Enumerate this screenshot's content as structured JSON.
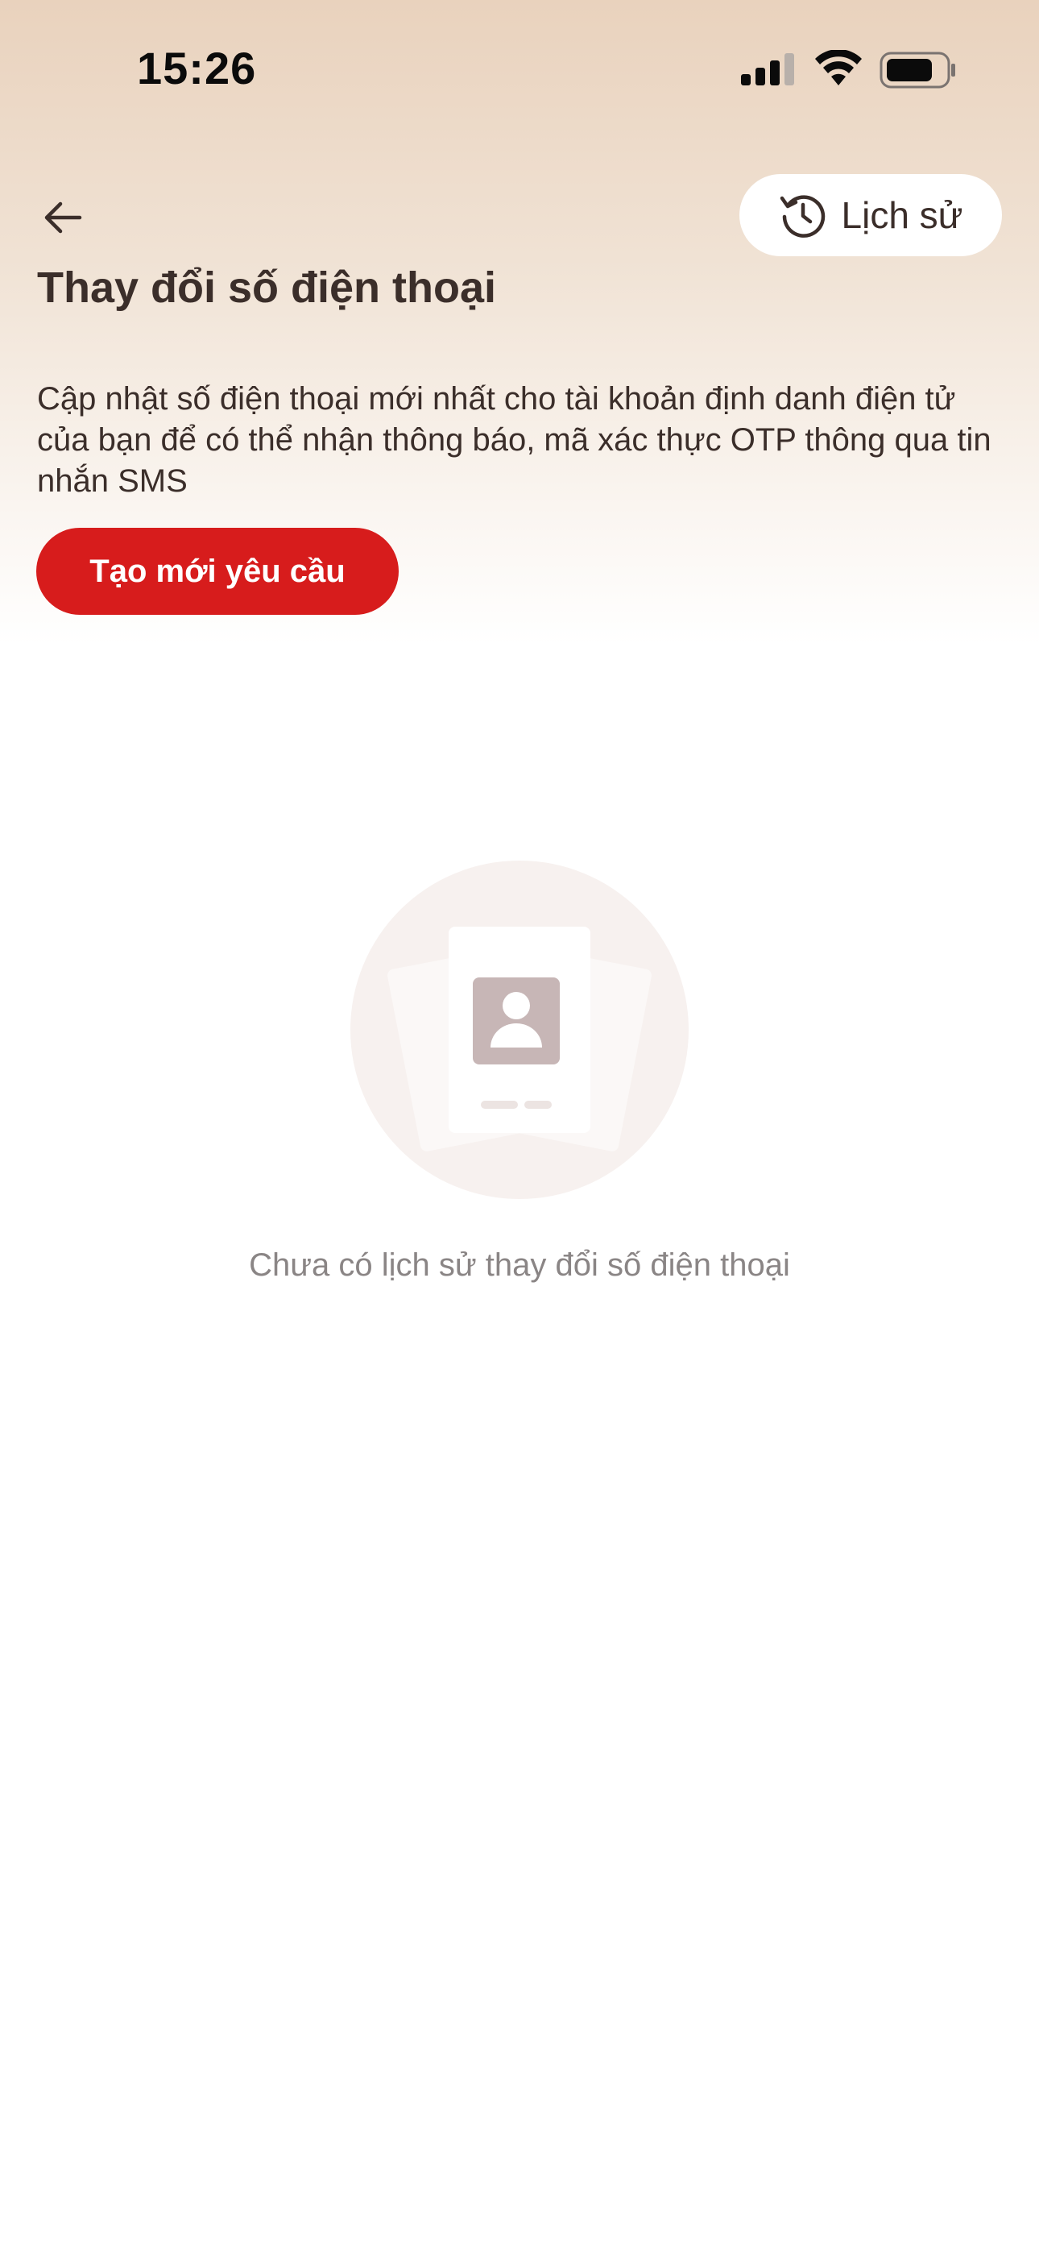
{
  "status_bar": {
    "time": "15:26",
    "icons": [
      "signal-icon",
      "wifi-icon",
      "battery-icon"
    ]
  },
  "header": {
    "back_icon": "arrow-left-icon",
    "history_button": {
      "icon": "history-clock-icon",
      "label": "Lịch sử"
    },
    "title": "Thay đổi số điện thoại",
    "description": "Cập nhật số điện thoại mới nhất cho tài khoản định danh điện tử của bạn để có thể nhận thông báo, mã xác thực OTP thông qua tin nhắn SMS",
    "create_button_label": "Tạo mới yêu cầu"
  },
  "empty_state": {
    "illustration": "id-card-person-icon",
    "message": "Chưa có lịch sử thay đổi số điện thoại"
  },
  "colors": {
    "accent": "#d71c1c",
    "text": "#3b2e2a",
    "muted_text": "#8a8585",
    "header_gradient_top": "#e9d2bd"
  }
}
